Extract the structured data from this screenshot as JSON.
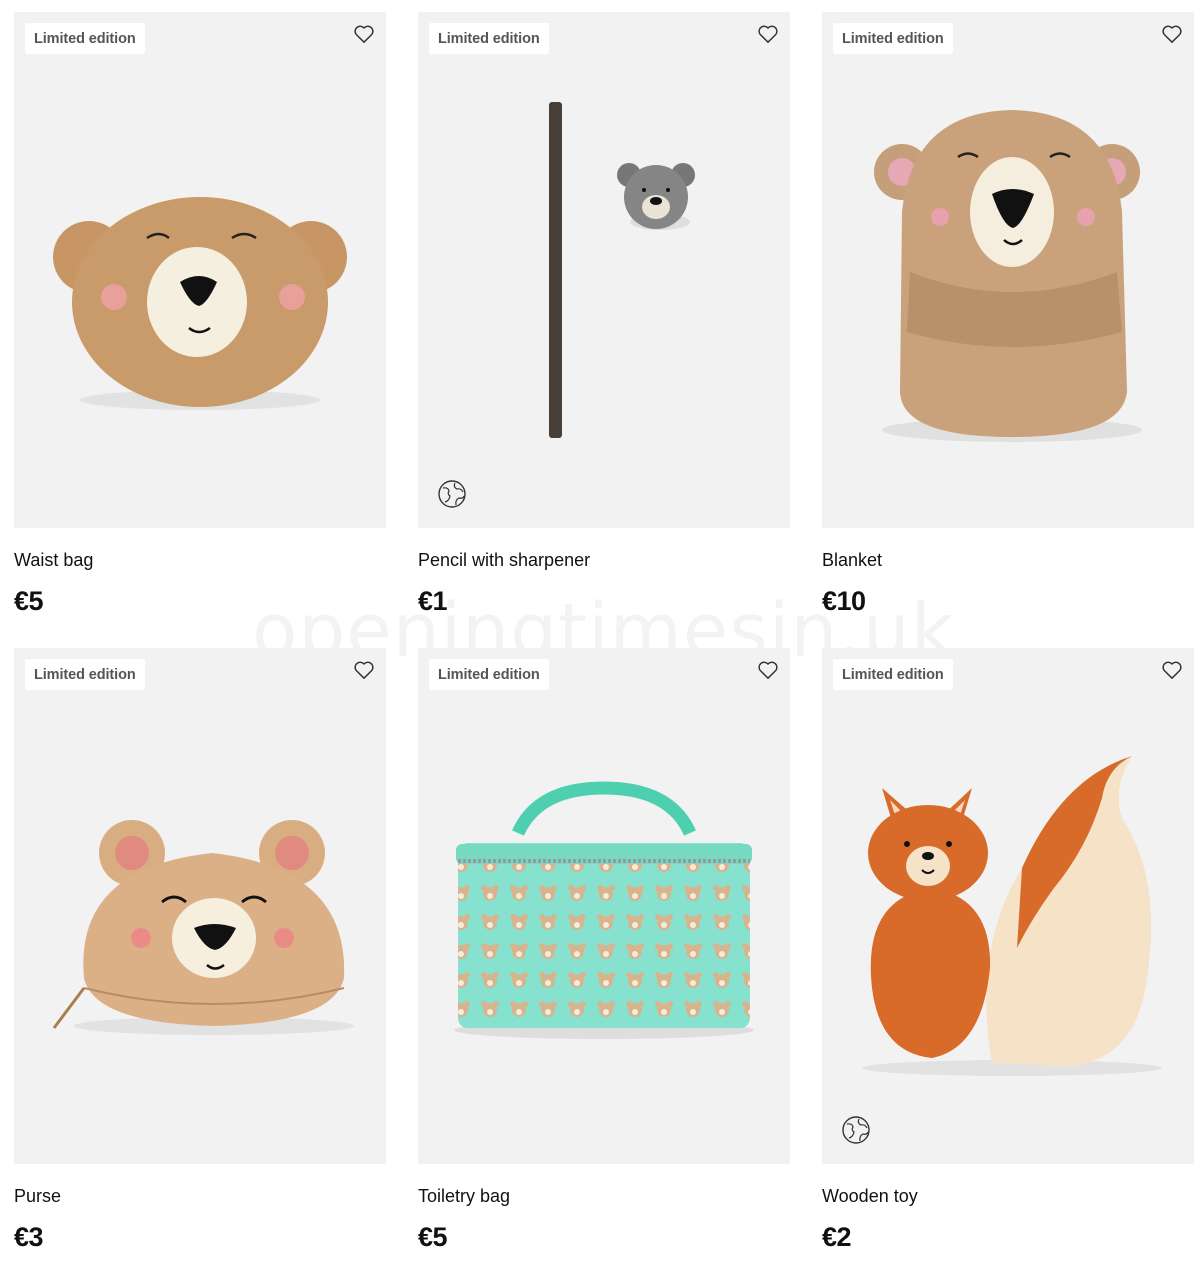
{
  "products": [
    {
      "badge": "Limited edition",
      "name": "Waist bag",
      "price": "€5",
      "sustainable": false,
      "image": "teddy-bear-waist-bag"
    },
    {
      "badge": "Limited edition",
      "name": "Pencil with sharpener",
      "price": "€1",
      "sustainable": true,
      "image": "pencil-with-bear-sharpener"
    },
    {
      "badge": "Limited edition",
      "name": "Blanket",
      "price": "€10",
      "sustainable": false,
      "image": "bear-hooded-blanket"
    },
    {
      "badge": "Limited edition",
      "name": "Purse",
      "price": "€3",
      "sustainable": false,
      "image": "bear-face-purse"
    },
    {
      "badge": "Limited edition",
      "name": "Toiletry bag",
      "price": "€5",
      "sustainable": false,
      "image": "mint-bear-pattern-toiletry-bag"
    },
    {
      "badge": "Limited edition",
      "name": "Wooden toy",
      "price": "€2",
      "sustainable": true,
      "image": "wooden-squirrel-toy"
    }
  ],
  "watermark": "openingtimesin.uk",
  "colors": {
    "card_bg": "#f2f2f2",
    "text": "#111111",
    "badge_text": "#555555"
  }
}
